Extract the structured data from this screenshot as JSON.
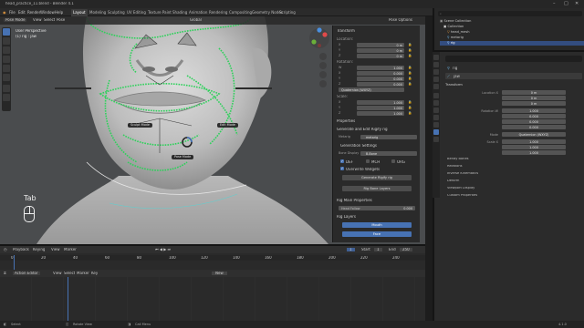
{
  "app": {
    "title": "head_practice_11.blend - Blender 4.1",
    "window_controls": [
      "–",
      "□",
      "✕"
    ]
  },
  "menubar": {
    "items": [
      "File",
      "Edit",
      "Render",
      "Window",
      "Help"
    ],
    "workspaces": [
      "Layout",
      "Modeling",
      "Sculpting",
      "UV Editing",
      "Texture Paint",
      "Shading",
      "Animation",
      "Rendering",
      "Compositing",
      "Geometry Nodes",
      "Scripting"
    ],
    "active_workspace": "Layout",
    "scene_label": "Scene",
    "view_layer_label": "ViewLayer"
  },
  "viewport": {
    "mode": "Pose Mode",
    "header_items": [
      "View",
      "Select",
      "Pose"
    ],
    "orientation_label": "Global",
    "perspective_label": "User Perspective",
    "object_label": "(1) rig : jaw",
    "options_label": "Pose Options",
    "tab_hint": "Tab",
    "pie_items": [
      {
        "label": "Sculpt Mode"
      },
      {
        "label": "Edit Mode"
      },
      {
        "label": "Pose Mode"
      }
    ]
  },
  "npanel": {
    "transform_header": "Transform",
    "location_label": "Location:",
    "rotation_label": "Rotation:",
    "scale_label": "Scale:",
    "location": [
      {
        "axis": "X",
        "value": "0 m"
      },
      {
        "axis": "Y",
        "value": "0 m"
      },
      {
        "axis": "Z",
        "value": "0 m"
      }
    ],
    "rotation": [
      {
        "axis": "W",
        "value": "1.000"
      },
      {
        "axis": "X",
        "value": "0.000"
      },
      {
        "axis": "Y",
        "value": "0.000"
      },
      {
        "axis": "Z",
        "value": "0.000"
      }
    ],
    "rotation_mode": "Quaternion (WXYZ)",
    "scale": [
      {
        "axis": "X",
        "value": "1.000"
      },
      {
        "axis": "Y",
        "value": "1.000"
      },
      {
        "axis": "Z",
        "value": "1.000"
      }
    ],
    "properties_header": "Properties",
    "rigify_header": "Generate and Edit Rigify rig",
    "metarig_label": "Metarig",
    "metarig_value": "metarig",
    "generation_header": "Generation Settings",
    "bone_display_label": "Bone Display",
    "bone_display_value": "B-Bone",
    "bone_flags": [
      "DEF",
      "MCH",
      "ORG"
    ],
    "overwrite_label": "Overwrite Widgets",
    "generate_button": "Generate Rigify rig",
    "rig_ui_button": "Rig Bone Layers",
    "bone_props_header": "Rig Main Properties",
    "head_follow_label": "Head Follow",
    "head_follow_value": "0.000",
    "layers_header": "Rig Layers",
    "layer_buttons": [
      "Mouth",
      "Face"
    ]
  },
  "outliner": {
    "search_placeholder": "",
    "rows": [
      {
        "label": "Scene Collection",
        "selected": false
      },
      {
        "label": "Collection",
        "selected": false
      },
      {
        "label": "head_mesh",
        "selected": false
      },
      {
        "label": "metarig",
        "selected": false
      },
      {
        "label": "rig",
        "selected": true
      }
    ]
  },
  "properties": {
    "object_name": "rig",
    "bone_name": "jaw",
    "transform_header": "Transform",
    "location_label": "Location X",
    "rotation_label": "Rotation W",
    "mode_label": "Mode",
    "mode_value": "Quaternion (WXYZ)",
    "scale_label": "Scale X",
    "location": [
      "0 m",
      "0 m",
      "0 m"
    ],
    "rotation": [
      "1.000",
      "0.000",
      "0.000",
      "0.000"
    ],
    "scale": [
      "1.000",
      "1.000",
      "1.000"
    ],
    "sections": [
      "Bendy Bones",
      "Relations",
      "Inverse Kinematics",
      "Deform",
      "Viewport Display",
      "Custom Properties"
    ]
  },
  "timeline": {
    "header_items": [
      "Playback",
      "Keying",
      "View",
      "Marker"
    ],
    "frame_current": "1",
    "start_label": "Start",
    "start_value": "1",
    "end_label": "End",
    "end_value": "250",
    "ticks": [
      "0",
      "20",
      "40",
      "60",
      "80",
      "100",
      "120",
      "140",
      "160",
      "180",
      "200",
      "220",
      "240"
    ],
    "dopesheet_mode": "Action Editor",
    "dopesheet_items": [
      "View",
      "Select",
      "Marker",
      "Key"
    ],
    "new_button": "New"
  },
  "statusbar": {
    "left": "Select",
    "middle": "Rotate View",
    "right": "Call Menu",
    "version": "4.1.0"
  },
  "colors": {
    "accent": "#4772b3",
    "mesh_wire": "#2dd15a",
    "viewport_bg": "#4a4c4e"
  }
}
